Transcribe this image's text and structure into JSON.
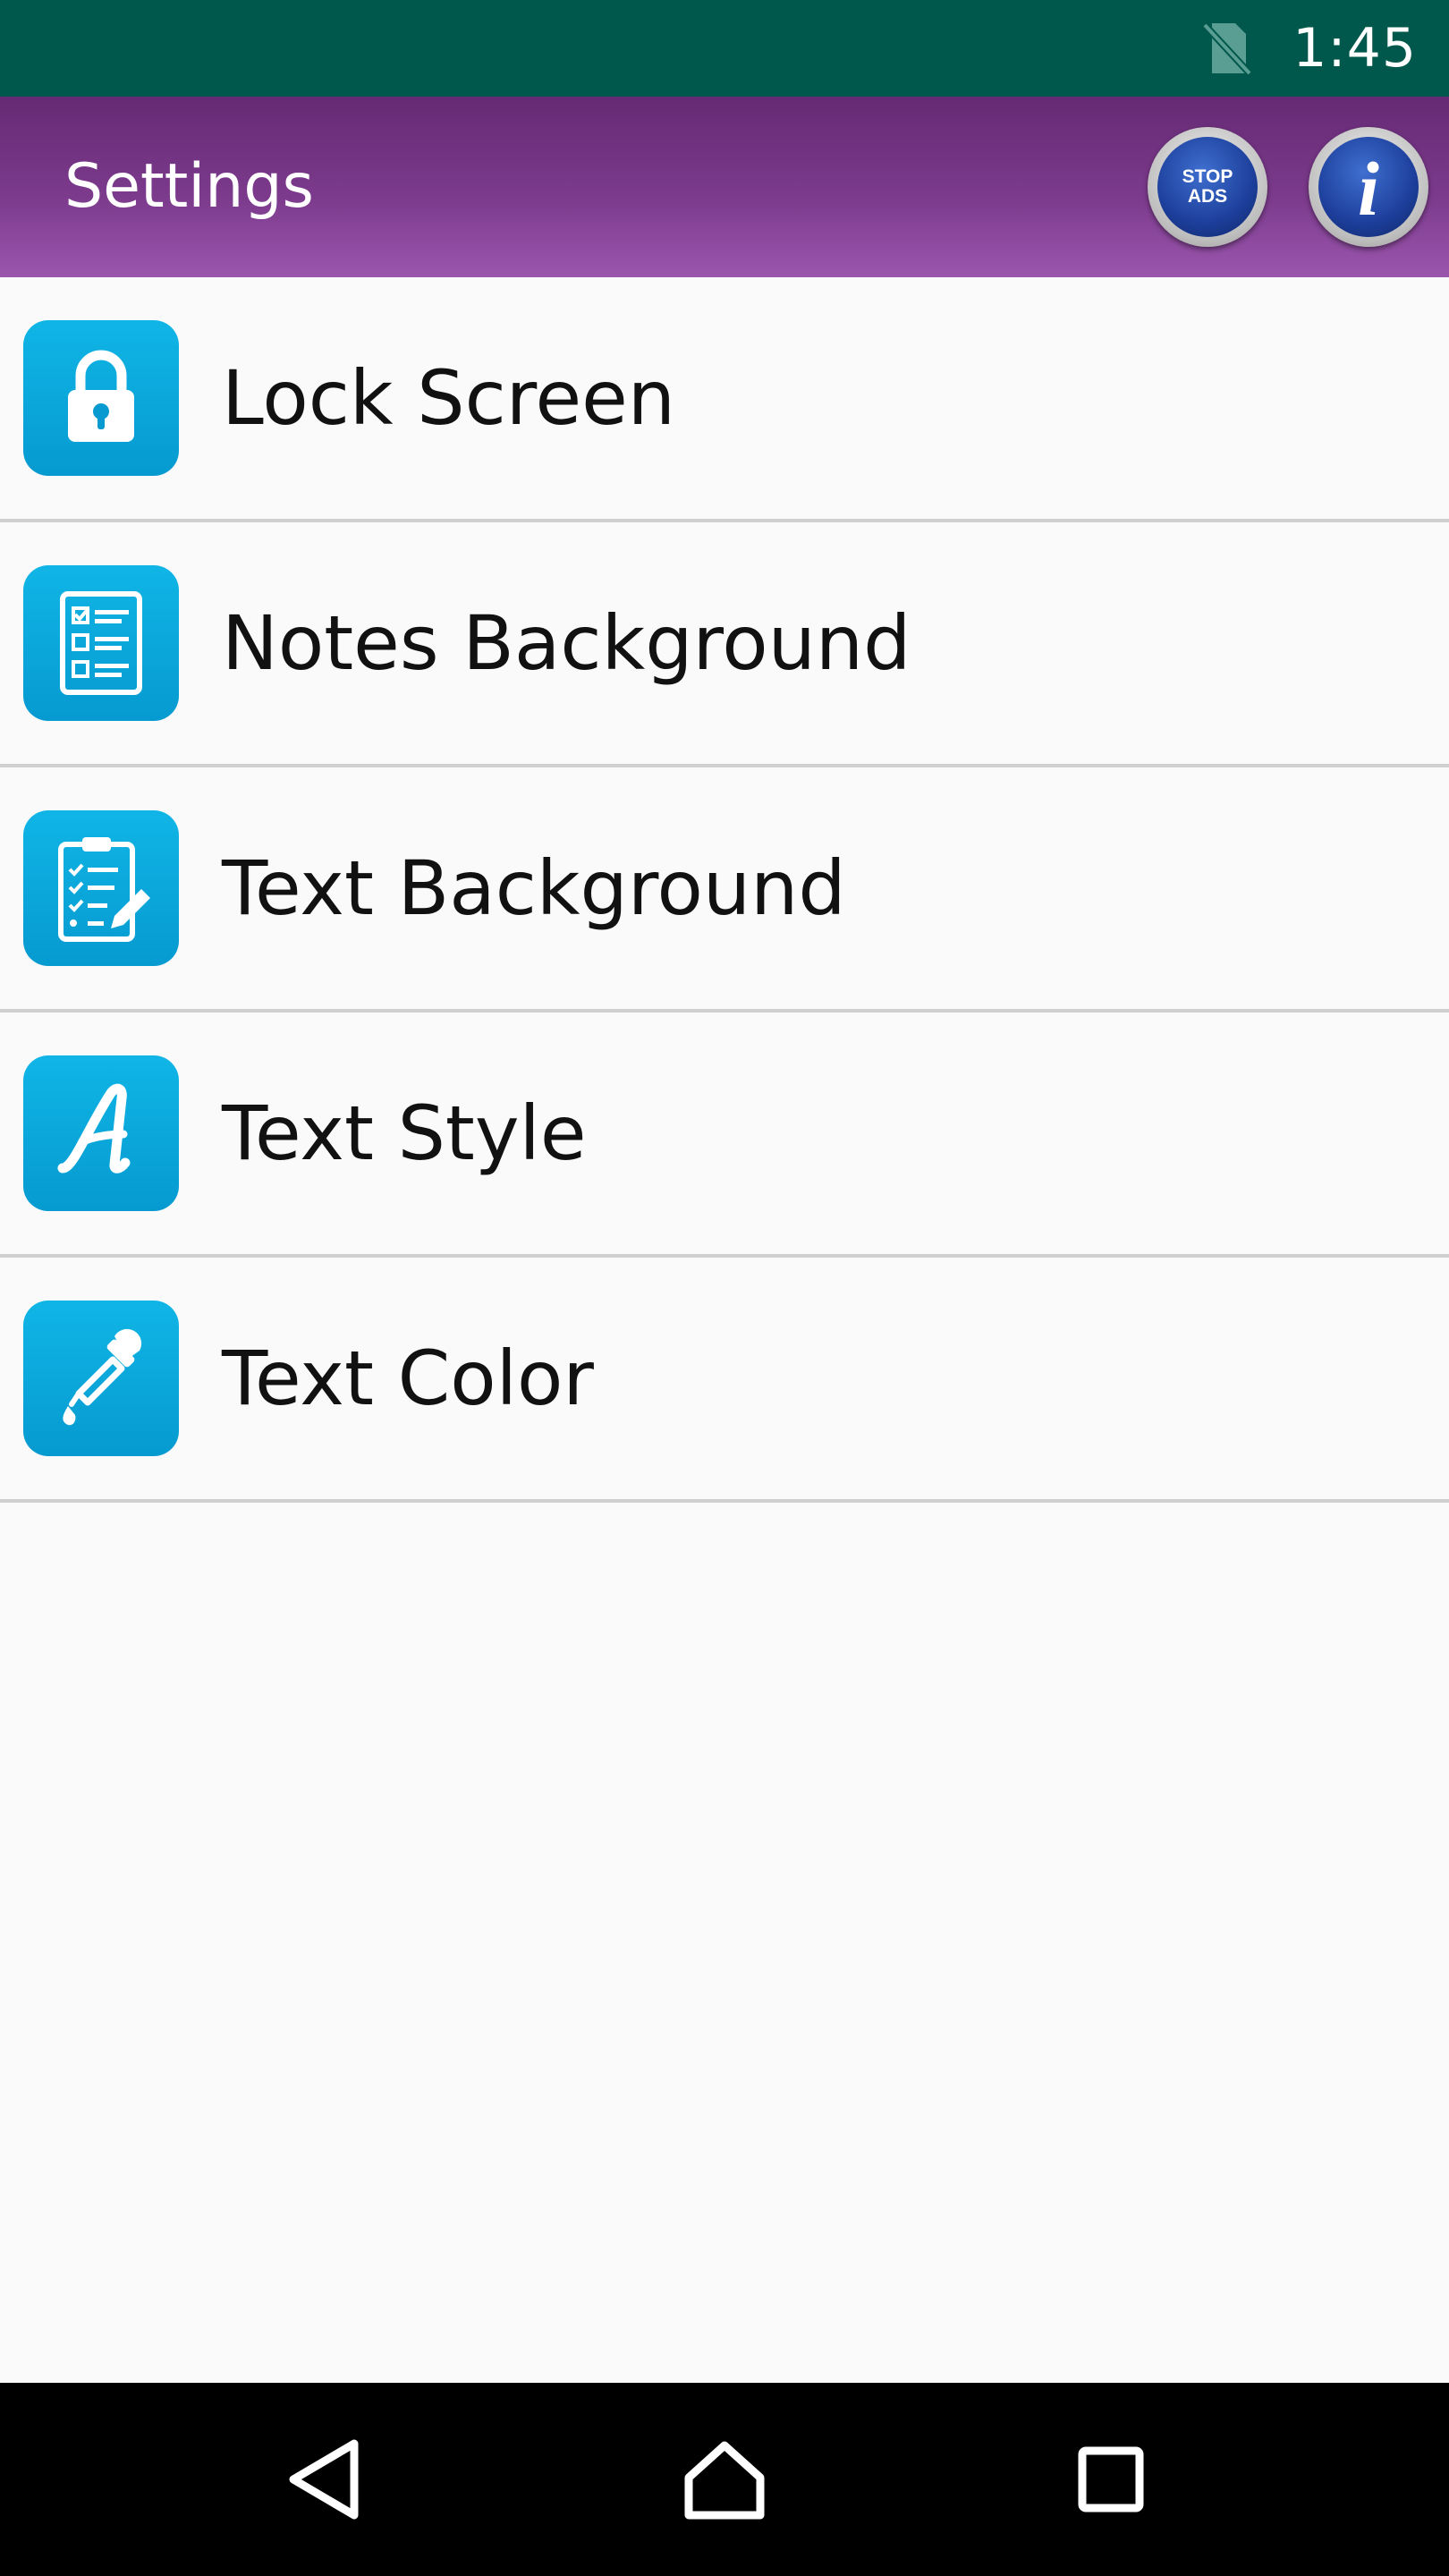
{
  "status_bar": {
    "time": "1:45",
    "icons": [
      "no-sim-icon"
    ]
  },
  "app_bar": {
    "title": "Settings",
    "stop_ads_label": "STOP\nADS",
    "info_label": "i"
  },
  "settings": {
    "items": [
      {
        "label": "Lock Screen",
        "icon": "lock-icon"
      },
      {
        "label": "Notes Background",
        "icon": "checklist-icon"
      },
      {
        "label": "Text Background",
        "icon": "clipboard-pencil-icon"
      },
      {
        "label": "Text Style",
        "icon": "script-letter-icon"
      },
      {
        "label": "Text Color",
        "icon": "eyedropper-icon"
      }
    ]
  },
  "nav_bar": {
    "icons": [
      "back-triangle-icon",
      "home-icon",
      "recents-square-icon"
    ]
  },
  "colors": {
    "status_bar": "#00574b",
    "app_bar_top": "#652a74",
    "app_bar_bottom": "#9a56ad",
    "icon_tile": "#069ad0",
    "list_background": "#fafafa",
    "divider": "#cfcfcf",
    "nav_bar": "#000000"
  }
}
